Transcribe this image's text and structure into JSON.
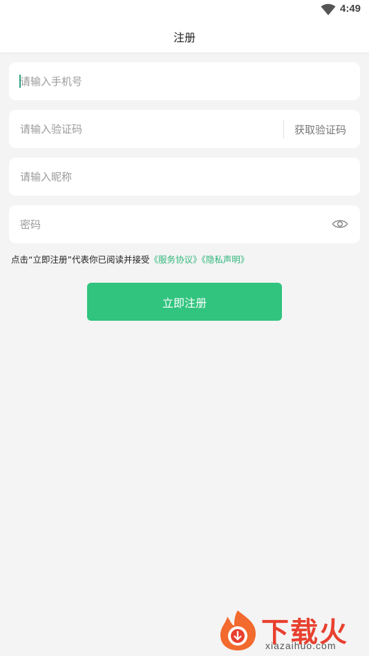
{
  "status_bar": {
    "time": "4:49",
    "wifi_icon": "wifi-icon"
  },
  "header": {
    "title": "注册"
  },
  "form": {
    "phone": {
      "placeholder": "请输入手机号",
      "value": ""
    },
    "code": {
      "placeholder": "请输入验证码",
      "value": "",
      "get_code_label": "获取验证码"
    },
    "nickname": {
      "placeholder": "请输入昵称",
      "value": ""
    },
    "password": {
      "placeholder": "密码",
      "value": "",
      "toggle_icon": "eye-icon"
    }
  },
  "agreement": {
    "prefix": "点击“立即注册”代表你已阅读并接受",
    "service_link": "《服务协议》",
    "privacy_link": "《隐私声明》"
  },
  "actions": {
    "register_label": "立即注册"
  },
  "watermark": {
    "title": "下载火",
    "subtitle": "xiazaihuo.com"
  },
  "colors": {
    "accent": "#31c47f",
    "link": "#2fb67a",
    "background": "#f4f4f4"
  }
}
